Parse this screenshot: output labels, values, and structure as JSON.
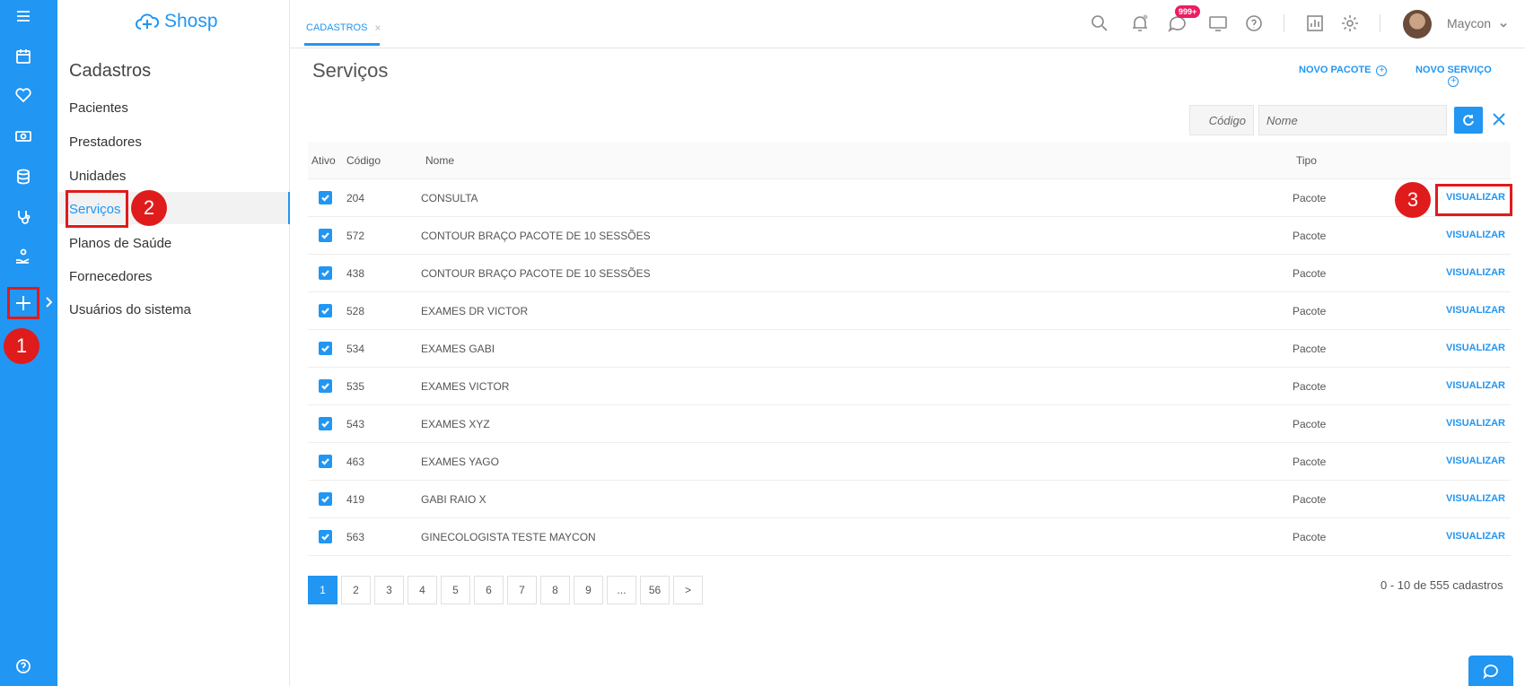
{
  "app": {
    "logo_text": "Shosp"
  },
  "header": {
    "tab_label": "CADASTROS",
    "tab_close": "×",
    "chat_badge": "999+",
    "username": "Maycon"
  },
  "subnav": {
    "title": "Cadastros",
    "items": [
      {
        "label": "Pacientes"
      },
      {
        "label": "Prestadores"
      },
      {
        "label": "Unidades"
      },
      {
        "label": "Serviços"
      },
      {
        "label": "Planos de Saúde"
      },
      {
        "label": "Fornecedores"
      },
      {
        "label": "Usuários do sistema"
      }
    ]
  },
  "callouts": [
    "1",
    "2",
    "3"
  ],
  "main": {
    "title": "Serviços",
    "new_package": "NOVO PACOTE",
    "new_service": "NOVO SERVIÇO",
    "filter_code_placeholder": "Código",
    "filter_name_placeholder": "Nome",
    "columns": {
      "active": "Ativo",
      "code": "Código",
      "name": "Nome",
      "type": "Tipo"
    },
    "rows": [
      {
        "code": "204",
        "name": "CONSULTA",
        "type": "Pacote",
        "action": "VISUALIZAR"
      },
      {
        "code": "572",
        "name": "CONTOUR BRAÇO PACOTE DE 10 SESSÕES",
        "type": "Pacote",
        "action": "VISUALIZAR"
      },
      {
        "code": "438",
        "name": "CONTOUR BRAÇO PACOTE DE 10 SESSÕES",
        "type": "Pacote",
        "action": "VISUALIZAR"
      },
      {
        "code": "528",
        "name": "EXAMES DR VICTOR",
        "type": "Pacote",
        "action": "VISUALIZAR"
      },
      {
        "code": "534",
        "name": "EXAMES GABI",
        "type": "Pacote",
        "action": "VISUALIZAR"
      },
      {
        "code": "535",
        "name": "EXAMES VICTOR",
        "type": "Pacote",
        "action": "VISUALIZAR"
      },
      {
        "code": "543",
        "name": "EXAMES XYZ",
        "type": "Pacote",
        "action": "VISUALIZAR"
      },
      {
        "code": "463",
        "name": "EXAMES YAGO",
        "type": "Pacote",
        "action": "VISUALIZAR"
      },
      {
        "code": "419",
        "name": "GABI RAIO X",
        "type": "Pacote",
        "action": "VISUALIZAR"
      },
      {
        "code": "563",
        "name": "GINECOLOGISTA TESTE MAYCON",
        "type": "Pacote",
        "action": "VISUALIZAR"
      }
    ],
    "pagination": [
      "1",
      "2",
      "3",
      "4",
      "5",
      "6",
      "7",
      "8",
      "9",
      "...",
      "56",
      ">"
    ],
    "record_count": "0 - 10 de 555 cadastros"
  },
  "colors": {
    "accent": "#2196f3",
    "callout": "#e01b1b",
    "badge": "#e91e63"
  }
}
